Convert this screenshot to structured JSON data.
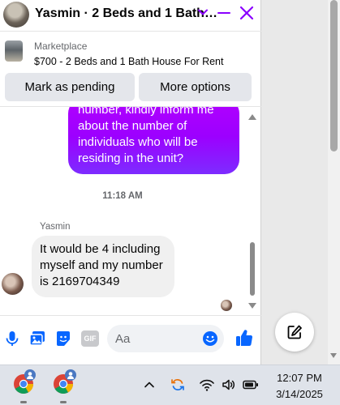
{
  "chat": {
    "title": "Yasmin · 2 Beds and 1 Bath…",
    "listing": {
      "label": "Marketplace",
      "title": "$700 - 2 Beds and 1 Bath House For Rent"
    },
    "actions": {
      "pending": "Mark as pending",
      "more": "More options"
    },
    "messages": {
      "outgoing_lines": [
        "number, kindly inform me",
        "about the number of",
        "individuals who will be",
        "residing in the unit?"
      ],
      "timestamp": "11:18 AM",
      "sender": "Yasmin",
      "incoming_lines": [
        "It would be 4 including",
        "myself and my number",
        "is 2169704349"
      ]
    },
    "composer": {
      "placeholder": "Aa",
      "gif_label": "GIF"
    }
  },
  "taskbar": {
    "time": "12:07 PM",
    "date": "3/14/2025"
  },
  "colors": {
    "accent": "#8a00ff",
    "messenger_blue": "#0866ff",
    "bubble_in": "#f0f0f0"
  },
  "icons": [
    "chevron-down-icon",
    "minimize-icon",
    "close-icon",
    "microphone-icon",
    "photo-icon",
    "sticker-icon",
    "gif-icon",
    "emoji-icon",
    "thumbs-up-icon",
    "new-message-icon",
    "chrome-icon",
    "chevron-up-icon",
    "sync-icon",
    "wifi-icon",
    "volume-icon",
    "battery-icon"
  ]
}
